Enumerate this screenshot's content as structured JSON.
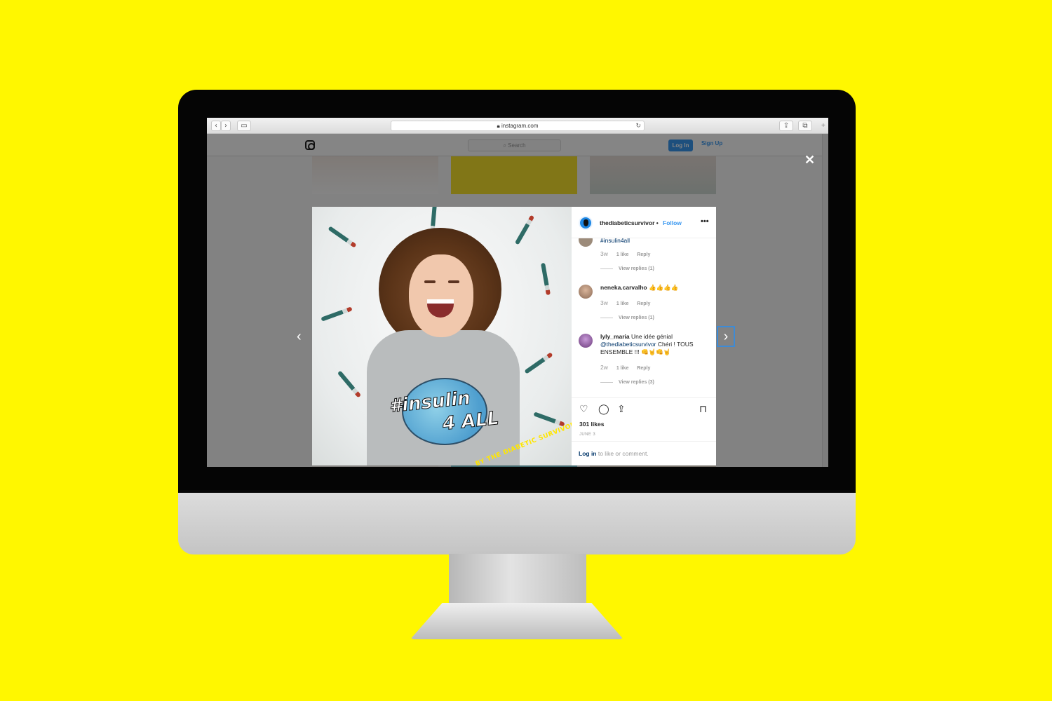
{
  "browser": {
    "url": "instagram.com",
    "back_icon": "chevron-left",
    "forward_icon": "chevron-right"
  },
  "instagram": {
    "search_placeholder": "Search",
    "login_label": "Log In",
    "signup_label": "Sign Up"
  },
  "post": {
    "username": "thediabeticsurvivor",
    "separator": "•",
    "follow_label": "Follow",
    "more_icon": "•••",
    "photo_text_line1": "#insulin",
    "photo_text_line2": "4 ALL",
    "signature": "BY THE DIABETIC SURVIVOR",
    "likes": "301 likes",
    "date": "JUNE 3"
  },
  "comments": [
    {
      "user": "",
      "text": "#insulin4all",
      "time": "3w",
      "likes": "1 like",
      "reply": "Reply",
      "view_replies": "View replies (1)"
    },
    {
      "user": "neneka.carvalho",
      "text": "👍👍👍👍",
      "time": "3w",
      "likes": "1 like",
      "reply": "Reply",
      "view_replies": "View replies (1)"
    },
    {
      "user": "lyly_maria",
      "text_before": "Une idée génial",
      "mention": "@thediabeticsurvivor",
      "text_after": "Chéri ! TOUS ENSEMBLE !!! 👊🤘👊🤘",
      "time": "2w",
      "likes": "1 like",
      "reply": "Reply",
      "view_replies": "View replies (3)"
    }
  ],
  "login_prompt": {
    "link": "Log in",
    "text": " to like or comment."
  },
  "colors": {
    "background": "#fff700",
    "ig_blue": "#3897f0",
    "link_dark": "#003569"
  }
}
